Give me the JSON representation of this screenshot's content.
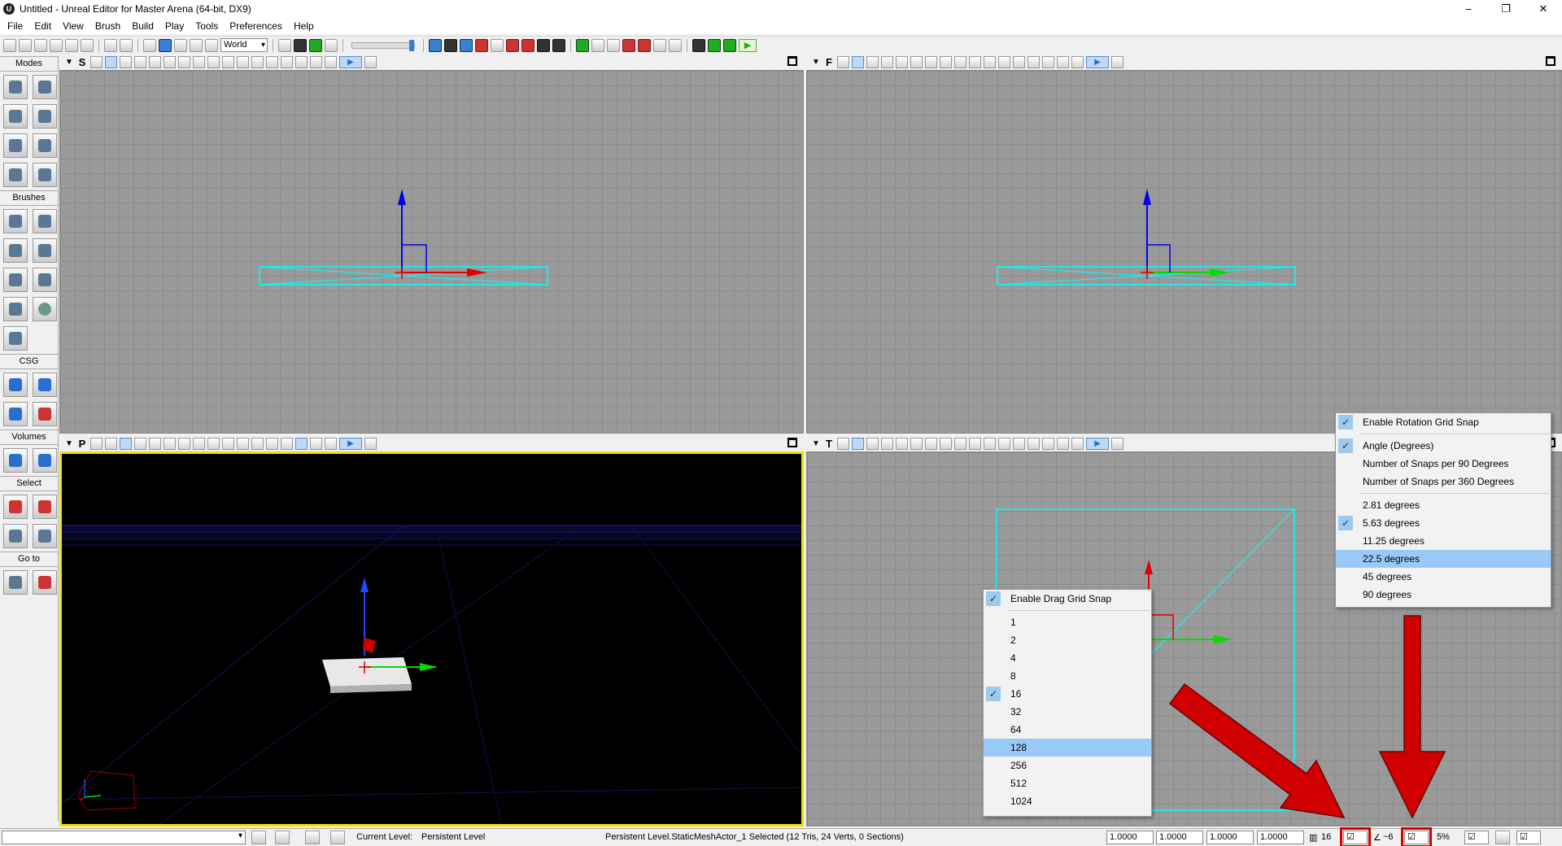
{
  "window": {
    "app_icon": "unreal-logo-icon",
    "title": "Untitled - Unreal Editor for Master Arena (64-bit, DX9)",
    "minimize": "–",
    "maximize": "❐",
    "close": "✕"
  },
  "menu": [
    "File",
    "Edit",
    "View",
    "Brush",
    "Build",
    "Play",
    "Tools",
    "Preferences",
    "Help"
  ],
  "toolbar": {
    "coord_system": "World",
    "play_icon": "▶"
  },
  "sidepanel": {
    "sections": {
      "modes": "Modes",
      "brushes": "Brushes",
      "csg": "CSG",
      "volumes": "Volumes",
      "select": "Select",
      "goto": "Go to"
    }
  },
  "viewports": {
    "top_left": {
      "label": "S",
      "play": "▶"
    },
    "top_right": {
      "label": "F",
      "play": "▶"
    },
    "bottom_left": {
      "label": "P",
      "play": "▶"
    },
    "bottom_right": {
      "label": "T",
      "play": "▶"
    },
    "dropdown_arrow": "▼"
  },
  "drag_grid_menu": {
    "items": [
      {
        "label": "Enable Drag Grid Snap",
        "checked": true
      },
      {
        "label": "1"
      },
      {
        "label": "2"
      },
      {
        "label": "4"
      },
      {
        "label": "8"
      },
      {
        "label": "16",
        "checked": true
      },
      {
        "label": "32"
      },
      {
        "label": "64"
      },
      {
        "label": "128",
        "highlighted": true
      },
      {
        "label": "256"
      },
      {
        "label": "512"
      },
      {
        "label": "1024"
      }
    ]
  },
  "rotation_grid_menu": {
    "items": [
      {
        "label": "Enable Rotation Grid Snap",
        "checked": true
      },
      {
        "label": "Angle (Degrees)",
        "checked": true
      },
      {
        "label": "Number of Snaps per 90 Degrees"
      },
      {
        "label": "Number of Snaps per 360 Degrees"
      },
      {
        "label": "2.81 degrees"
      },
      {
        "label": "5.63 degrees",
        "checked": true
      },
      {
        "label": "11.25 degrees"
      },
      {
        "label": "22.5 degrees",
        "highlighted": true
      },
      {
        "label": "45 degrees"
      },
      {
        "label": "90 degrees"
      }
    ]
  },
  "statusbar": {
    "current_level_label": "Current Level:",
    "current_level": "Persistent Level",
    "selection_info": "Persistent Level.StaticMeshActor_1 Selected (12 Tris, 24 Verts, 0 Sections)",
    "fields": [
      "1.0000",
      "1.0000",
      "1.0000",
      "1.0000"
    ],
    "grid_size": "16",
    "rotation_snap": "~6",
    "scale_snap": "5%",
    "check": "☑"
  },
  "colors": {
    "annotation_arrow": "#d00000",
    "viewport_grid": "#9a9a9a",
    "selection_highlight": "#99c9f7",
    "perspective_border": "#f0e000"
  }
}
